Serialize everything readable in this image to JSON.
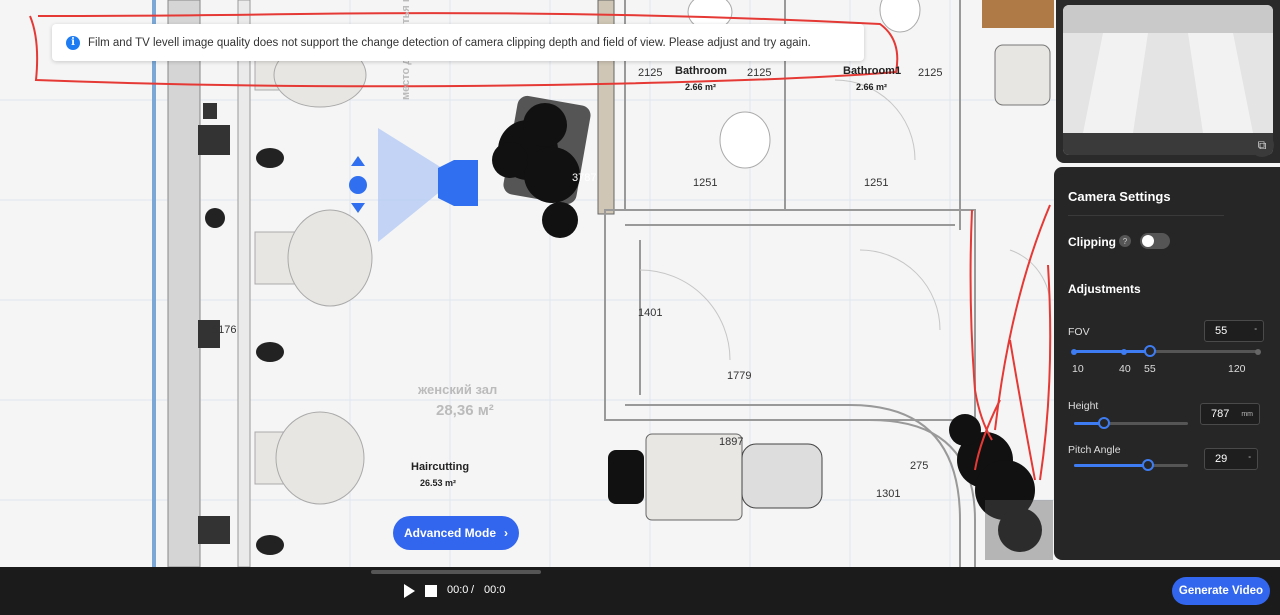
{
  "toast": {
    "icon": "info-icon",
    "message": "Film and TV levell image quality does not support the change detection of camera clipping depth and field of view. Please adjust and try again."
  },
  "plan": {
    "rooms": [
      {
        "name": "Bathroom",
        "area": "2.66 m²"
      },
      {
        "name": "Bathroom1",
        "area": "2.66 m²"
      },
      {
        "name": "Haircutting",
        "area": "26.53 m²"
      }
    ],
    "dimensions": [
      "2125",
      "2125",
      "2125",
      "1251",
      "1251",
      "3787",
      "1401",
      "1779",
      "6176",
      "1897",
      "275",
      "1301"
    ],
    "faded_text": {
      "hall_name": "женский зал",
      "hall_area": "28,36 м²",
      "wash_text": "место для мытья головы"
    }
  },
  "preview": {
    "expand_icon": "expand-icon"
  },
  "camera_settings": {
    "title": "Camera Settings",
    "clipping_label": "Clipping",
    "clipping_help": "?",
    "clipping_on": false,
    "adjustments_label": "Adjustments",
    "fov": {
      "label": "FOV",
      "value": "55",
      "unit": "°",
      "ticks": [
        "10",
        "40",
        "55",
        "120"
      ],
      "min": 10,
      "max": 120
    },
    "height": {
      "label": "Height",
      "value": "787",
      "unit": "mm",
      "fraction": 0.25
    },
    "pitch": {
      "label": "Pitch Angle",
      "value": "29",
      "unit": "°",
      "fraction": 0.6
    }
  },
  "advanced_mode": {
    "label": "Advanced Mode",
    "icon": "chevron-right-icon"
  },
  "player": {
    "current_time": "00:0",
    "separator": "/",
    "total_time": "00:0",
    "generate_label": "Generate Video"
  },
  "colors": {
    "accent": "#3366ee",
    "annotation": "#e53935",
    "panel": "#262626"
  }
}
